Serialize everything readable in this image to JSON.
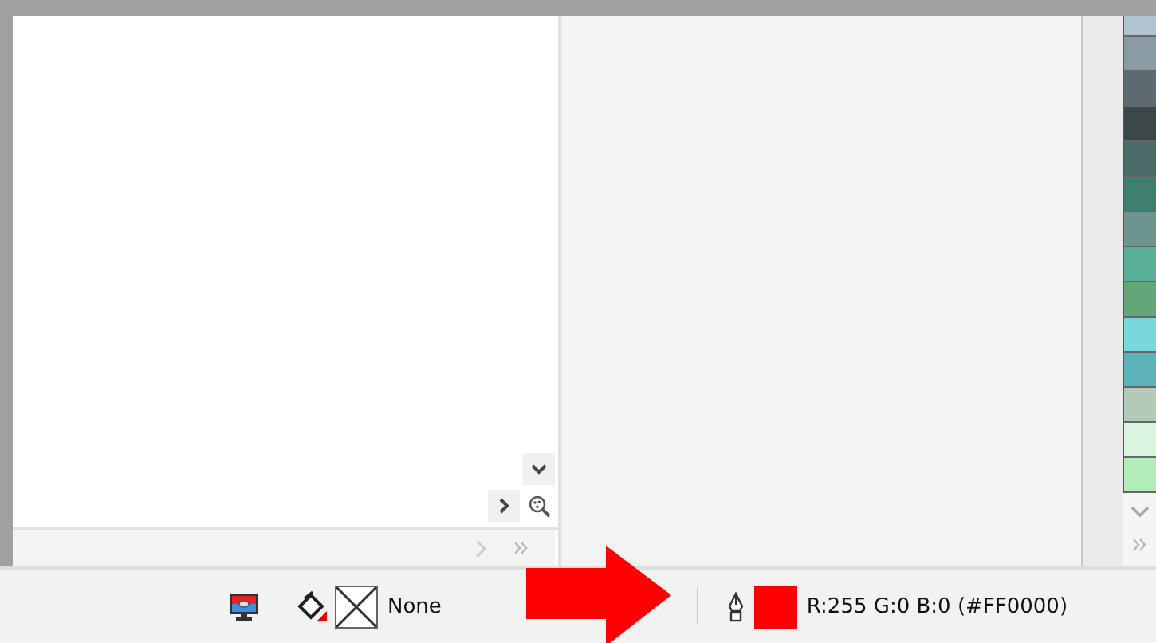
{
  "palette": [
    {
      "color": "#b0c4d0"
    },
    {
      "color": "#8a9ba3"
    },
    {
      "color": "#5d6a70"
    },
    {
      "color": "#3c474a"
    },
    {
      "color": "#4a6b67"
    },
    {
      "color": "#3e7f6f"
    },
    {
      "color": "#6c9590"
    },
    {
      "color": "#5aae98"
    },
    {
      "color": "#63a67a"
    },
    {
      "color": "#7ad8dc"
    },
    {
      "color": "#5db1b8"
    },
    {
      "color": "#b5c9b9"
    },
    {
      "color": "#daf5df"
    },
    {
      "color": "#b3ecb8"
    }
  ],
  "status_bar": {
    "fill_label": "None",
    "outline": {
      "color": "#ff0000",
      "label": "R:255 G:0 B:0 (#FF0000)"
    }
  }
}
